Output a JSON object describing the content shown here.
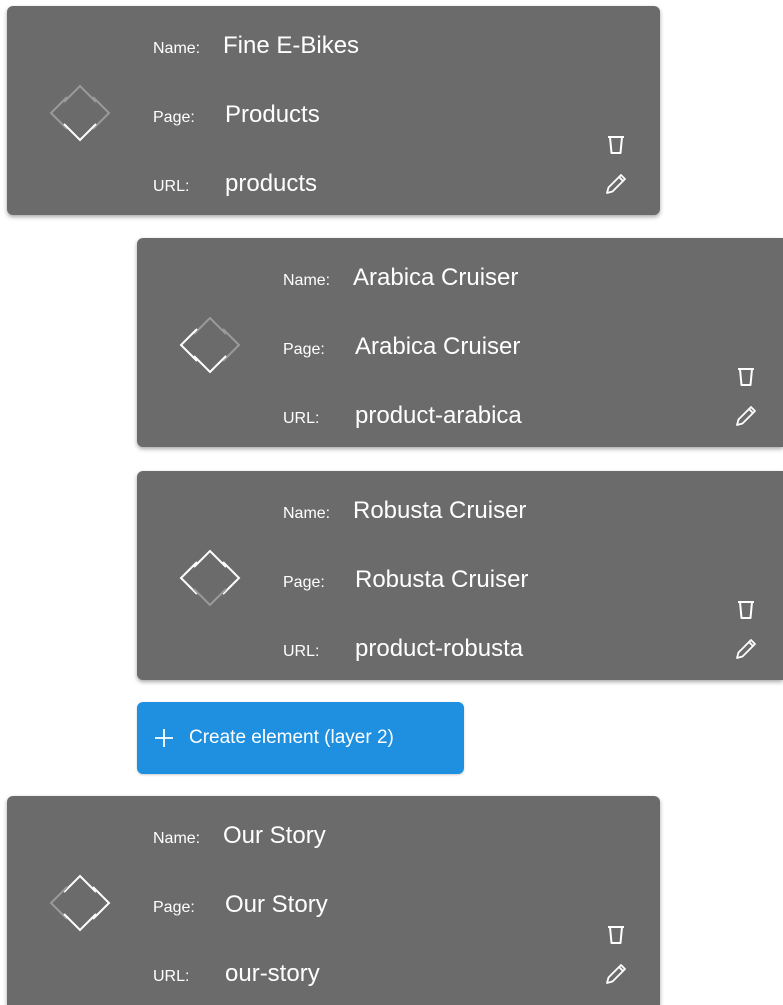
{
  "labels": {
    "name": "Name:",
    "page": "Page:",
    "url": "URL:"
  },
  "elements": [
    {
      "layer": 1,
      "name": "Fine E-Bikes",
      "page": "Products",
      "url": "products",
      "icon": "reorder-diamond-icon",
      "active_arrows": [
        "down"
      ]
    },
    {
      "layer": 2,
      "name": "Arabica Cruiser",
      "page": "Arabica Cruiser",
      "url": "product-arabica",
      "icon": "reorder-diamond-icon",
      "active_arrows": [
        "left",
        "down"
      ]
    },
    {
      "layer": 2,
      "name": "Robusta Cruiser",
      "page": "Robusta Cruiser",
      "url": "product-robusta",
      "icon": "reorder-diamond-icon",
      "active_arrows": [
        "up",
        "left",
        "right"
      ]
    },
    {
      "layer": 1,
      "name": "Our Story",
      "page": "Our Story",
      "url": "our-story",
      "icon": "reorder-diamond-icon",
      "active_arrows": [
        "up",
        "down"
      ]
    }
  ],
  "create_button": {
    "label": "Create element (layer 2)",
    "icon": "plus-icon"
  },
  "actions": {
    "delete_icon": "trash-icon",
    "edit_icon": "pencil-icon"
  },
  "colors": {
    "card_bg": "#6b6b6b",
    "accent": "#1f8fdf",
    "text": "#ffffff",
    "arrow_active": "#ffffff",
    "arrow_inactive": "#9a9a9a"
  }
}
